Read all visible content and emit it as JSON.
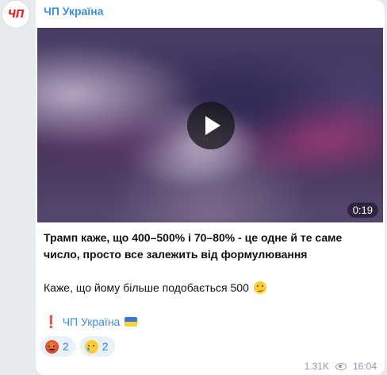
{
  "channel": {
    "name": "ЧП Україна",
    "avatar_text": "ЧП"
  },
  "video": {
    "duration": "0:19"
  },
  "post": {
    "line1": "Трамп каже, що 400–500% і 70–80% - це одне й те саме число, просто все залежить від формулювання",
    "line2": "Каже, що йому більше подобається 500",
    "signature": "ЧП Україна",
    "signature_prefix_icon": "red-exclamation-icon",
    "signature_suffix_icon": "ukraine-flag-icon"
  },
  "reactions": [
    {
      "emoji": "angry-face-icon",
      "count": "2"
    },
    {
      "emoji": "crying-face-icon",
      "count": "2"
    }
  ],
  "meta": {
    "views": "1.31K",
    "time": "16:04"
  },
  "colors": {
    "accent": "#3a8fd6",
    "avatar_red": "#e8262b",
    "reaction_bg": "#e8f0f8"
  }
}
